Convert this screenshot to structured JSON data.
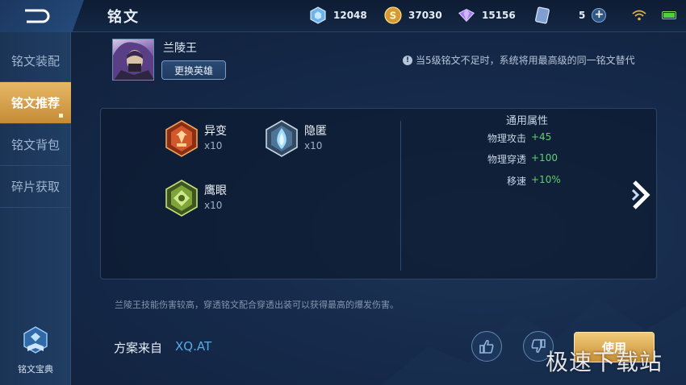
{
  "header": {
    "back_icon": "back-arrow-icon",
    "title": "铭文",
    "resources": [
      {
        "icon": "diamond-gem-icon",
        "value": "12048",
        "color": "#8fc8ff"
      },
      {
        "icon": "gold-coin-icon",
        "value": "37030",
        "color": "#e3b04a"
      },
      {
        "icon": "purple-crystal-icon",
        "value": "15156",
        "color": "#b58cff"
      },
      {
        "icon": "ticket-icon",
        "value": "5",
        "color": "#9bb7e6"
      }
    ],
    "add_icon": "plus-icon",
    "wifi_icon": "wifi-icon",
    "battery_icon": "battery-icon"
  },
  "sidebar": {
    "items": [
      {
        "label": "铭文装配",
        "active": false
      },
      {
        "label": "铭文推荐",
        "active": true
      },
      {
        "label": "铭文背包",
        "active": false
      },
      {
        "label": "碎片获取",
        "active": false
      }
    ],
    "codex_label": "铭文宝典"
  },
  "hero": {
    "name": "兰陵王",
    "change_button": "更换英雄"
  },
  "notice": "当5级铭文不足时，系统将用最高级的同一铭文替代",
  "runes": [
    {
      "name": "异变",
      "count": "x10",
      "color": "#d2572a"
    },
    {
      "name": "隐匿",
      "count": "x10",
      "color": "#7fc6ea"
    },
    {
      "name": "鹰眼",
      "count": "x10",
      "color": "#9bc94a"
    }
  ],
  "attributes": {
    "title": "通用属性",
    "rows": [
      {
        "key": "物理攻击",
        "value": "+45"
      },
      {
        "key": "物理穿透",
        "value": "+100"
      },
      {
        "key": "移速",
        "value": "+10%"
      }
    ]
  },
  "description": "兰陵王技能伤害较高，穿透铭文配合穿透出装可以获得最高的爆发伤害。",
  "source": {
    "label": "方案来自",
    "value": "XQ.AT"
  },
  "actions": {
    "like_icon": "thumbs-up-icon",
    "dislike_icon": "thumbs-down-icon",
    "use_label": "使用"
  },
  "watermark": "极速下载站",
  "colors": {
    "accent_gold": "#e0aa52",
    "positive_green": "#5ed16e",
    "link_blue": "#58a9e8"
  }
}
